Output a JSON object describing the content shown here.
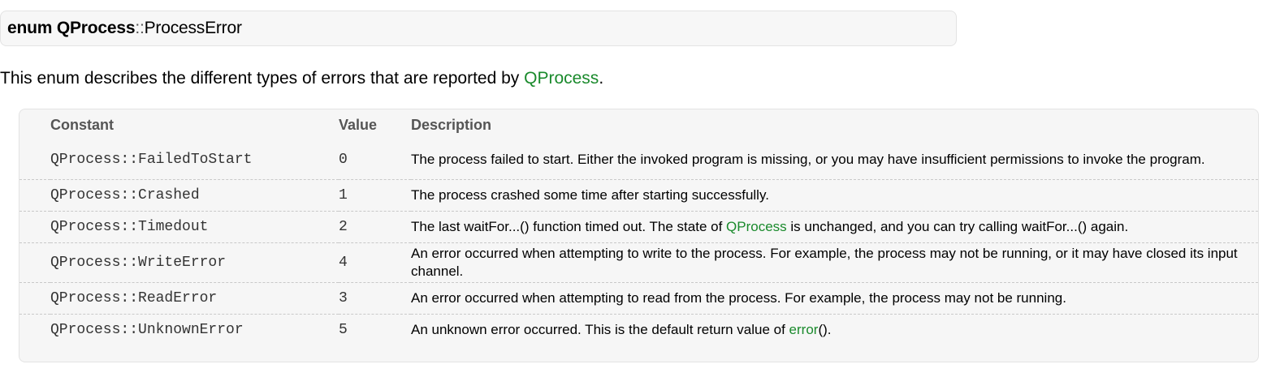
{
  "header": {
    "keyword": "enum",
    "class_name": "QProcess",
    "separator": "::",
    "enum_name": "ProcessError"
  },
  "intro": {
    "prefix": "This enum describes the different types of errors that are reported by ",
    "link": "QProcess",
    "suffix": "."
  },
  "table": {
    "headers": {
      "constant": "Constant",
      "value": "Value",
      "description": "Description"
    },
    "rows": [
      {
        "constant": "QProcess::FailedToStart",
        "value": "0",
        "desc": "The process failed to start. Either the invoked program is missing, or you may have insufficient permissions to invoke the program."
      },
      {
        "constant": "QProcess::Crashed",
        "value": "1",
        "desc": "The process crashed some time after starting successfully."
      },
      {
        "constant": "QProcess::Timedout",
        "value": "2",
        "desc_pre": "The last waitFor...() function timed out. The state of ",
        "desc_link": "QProcess",
        "desc_post": " is unchanged, and you can try calling waitFor...() again."
      },
      {
        "constant": "QProcess::WriteError",
        "value": "4",
        "desc": "An error occurred when attempting to write to the process. For example, the process may not be running, or it may have closed its input channel."
      },
      {
        "constant": "QProcess::ReadError",
        "value": "3",
        "desc": "An error occurred when attempting to read from the process. For example, the process may not be running."
      },
      {
        "constant": "QProcess::UnknownError",
        "value": "5",
        "desc_pre": "An unknown error occurred. This is the default return value of ",
        "desc_link": "error",
        "desc_post": "()."
      }
    ]
  },
  "colors": {
    "link": "#1a8a2c",
    "panel_bg": "#f6f6f6",
    "border": "#e3e3e3"
  }
}
